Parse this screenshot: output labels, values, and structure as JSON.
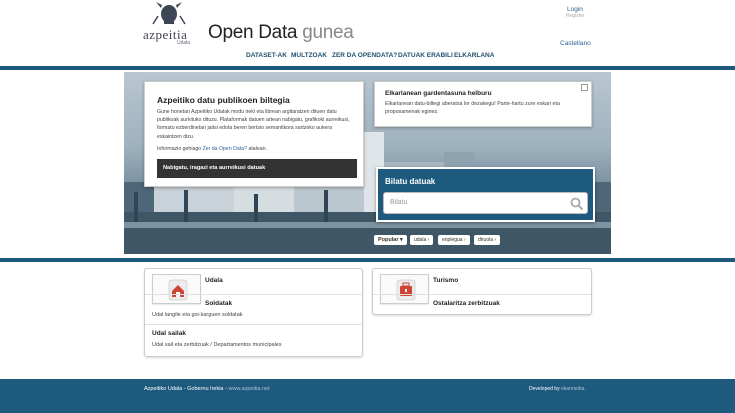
{
  "header": {
    "logo_text": "azpeitia",
    "logo_sub": "Udala",
    "title_strong": "Open Data",
    "title_light": "gunea",
    "login_label": "Login",
    "register_label": "Register",
    "language_label": "Castellano"
  },
  "nav": {
    "items": [
      "DATASET-AK",
      "MULTZOAK",
      "ZER DA OPENDATA?",
      "DATUAK ERABILI",
      "ELKARLANA"
    ]
  },
  "intro": {
    "title": "Azpeitiko datu publikoen biltegia",
    "description": "Gune honetan Azpeitiko Udalak modu ireki eta librean argitaratzen dituen datu publikoak aurkituko dituzu. Plataformak datuen artean nabigatu, grafikoki aurreikusi, formatu ezberdinetan jaitsi edota beren bertsio semantikora sartzeko aukera eskaintzen dizu.",
    "more_prefix": "Informazio gehiago",
    "more_link": "Zer da Open Data?",
    "more_suffix": "atalean.",
    "browse_button": "Nabigatu, iragazi eta aurreikusi datuak"
  },
  "collab": {
    "title": "Elkarlanean gardentasuna helburu",
    "text": "Elkarlanean datu-biltegi aberatsa lor dezakegu! Parte-hartu zure eskari eta proposamenak eginez."
  },
  "search": {
    "title": "Bilatu datuak",
    "placeholder": "Bilatu",
    "icon": "search-icon"
  },
  "tags": {
    "popular_label": "Popular",
    "items": [
      "udala",
      "enplegua",
      "diruola"
    ]
  },
  "groups": [
    {
      "name": "Udala",
      "icon": "house-icon",
      "datasets": [
        {
          "title": "Soldatak",
          "desc": "Udal langile eta goi-karguen soldatak"
        },
        {
          "title": "Udal sailak",
          "desc": "Udal sail eta zerbitzuak / Departamentos municipales"
        }
      ]
    },
    {
      "name": "Turismo",
      "icon": "briefcase-icon",
      "datasets": [
        {
          "title": "Ostalaritza zerbitzuak",
          "desc": ""
        }
      ]
    }
  ],
  "footer": {
    "org": "Azpeitiko Udala - Gobernu Irekia",
    "separator": " - ",
    "url": "www.azpeitia.net",
    "developed_prefix": "Developed by",
    "developer": "ekarmedia."
  },
  "colors": {
    "brand": "#1d5a7e",
    "link": "#2a6496"
  }
}
